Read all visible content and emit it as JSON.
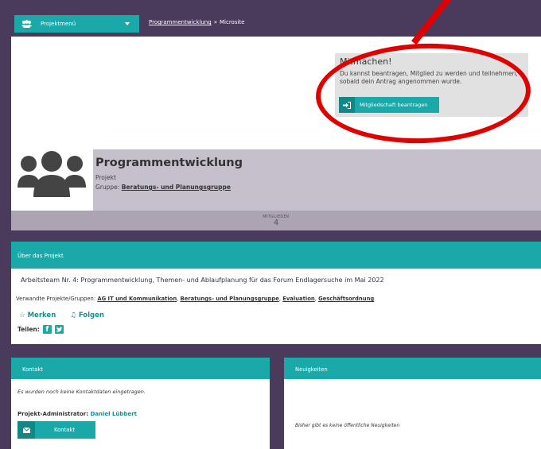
{
  "topbar": {
    "menu_label": "Projektmenü",
    "breadcrumb": {
      "parent": "Programmentwicklung",
      "separator": "»",
      "current": "Microsite"
    }
  },
  "join": {
    "title": "Mitmachen!",
    "text": "Du kannst beantragen, Mitglied zu werden und teilnehmen, sobald dein Antrag angenommen wurde.",
    "button_label": "Mitgliedschaft beantragen"
  },
  "project": {
    "title": "Programmentwicklung",
    "type": "Projekt",
    "group_prefix": "Gruppe:",
    "group_name": "Beratungs- und Planungsgruppe"
  },
  "members": {
    "label": "MITGLIEDER",
    "count": "4"
  },
  "about": {
    "heading": "Über das Projekt",
    "description": "Arbeitsteam Nr. 4: Programmentwicklung, Themen- und Ablaufplanung für das Forum Endlagersuche im Mai 2022",
    "related_prefix": "Verwandte Projekte/Gruppen:",
    "related": [
      "AG IT und Kommunikation",
      "Beratungs- und Planungsgruppe",
      "Evaluation",
      "Geschäftsordnung"
    ],
    "bookmark_label": "Merken",
    "follow_label": "Folgen",
    "share_label": "Teilen:"
  },
  "contact": {
    "heading": "Kontakt",
    "empty_text": "Es wurden noch keine Kontaktdaten eingetragen.",
    "admin_prefix": "Projekt-Administrator:",
    "admin_name": "Daniel Lübbert",
    "button_label": "Kontakt"
  },
  "news": {
    "heading": "Neuigkeiten",
    "empty_text": "Bisher gibt es keine öffentliche Neuigkeiten"
  },
  "colors": {
    "brand_purple": "#4a3b5c",
    "accent_teal": "#1aa8a8",
    "annotation_red": "#e00000"
  }
}
